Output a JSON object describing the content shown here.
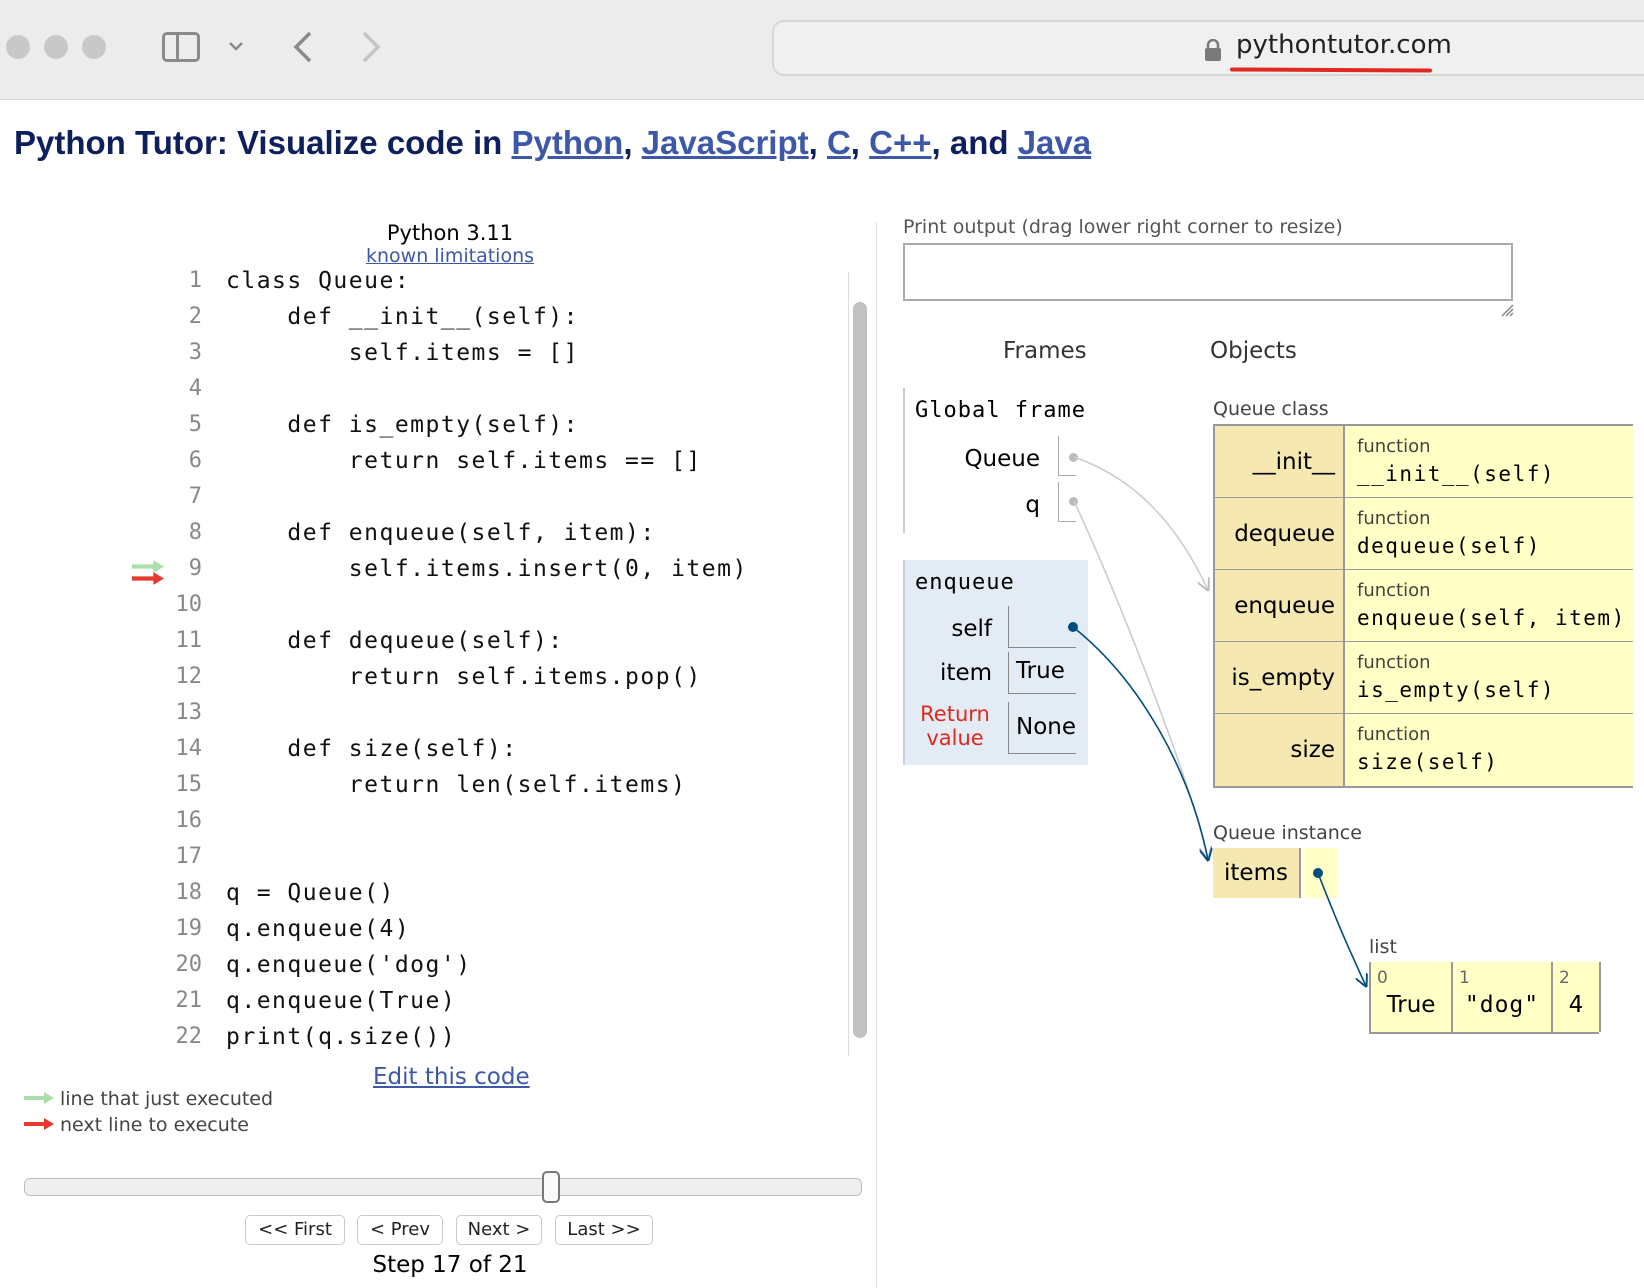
{
  "browser": {
    "url": "pythontutor.com"
  },
  "heading": {
    "prefix": "Python Tutor: Visualize code in ",
    "languages": [
      "Python",
      "JavaScript",
      "C",
      "C++",
      "Java"
    ],
    "sep1": ", ",
    "sep2": ", ",
    "sep3": ", ",
    "sep4": ", and "
  },
  "code_panel": {
    "language": "Python 3.11",
    "limitations_link": "known limitations",
    "lines": [
      "class Queue:",
      "    def __init__(self):",
      "        self.items = []",
      "",
      "    def is_empty(self):",
      "        return self.items == []",
      "",
      "    def enqueue(self, item):",
      "        self.items.insert(0, item)",
      "",
      "    def dequeue(self):",
      "        return self.items.pop()",
      "",
      "    def size(self):",
      "        return len(self.items)",
      "",
      "",
      "q = Queue()",
      "q.enqueue(4)",
      "q.enqueue('dog')",
      "q.enqueue(True)",
      "print(q.size())"
    ],
    "line_numbers": [
      "1",
      "2",
      "3",
      "4",
      "5",
      "6",
      "7",
      "8",
      "9",
      "10",
      "11",
      "12",
      "13",
      "14",
      "15",
      "16",
      "17",
      "18",
      "19",
      "20",
      "21",
      "22"
    ],
    "just_executed_line": 9,
    "next_line": 9,
    "edit_link": "Edit this code",
    "legend_just_executed": "line that just executed",
    "legend_next": "next line to execute"
  },
  "colors": {
    "just_executed_arrow": "#a9dfa9",
    "next_arrow": "#e8392f",
    "link": "#3d58a8",
    "heading": "#0d1f5c",
    "frame_bg": "#e3ebf5",
    "object_bg": "#ffffc6",
    "object_key_bg": "#f5e8b0",
    "pointer": "#004d80"
  },
  "navigation": {
    "first": "<< First",
    "prev": "< Prev",
    "next": "Next >",
    "last": "Last >>",
    "step_text": "Step 17 of 21",
    "current_step": 17,
    "total_steps": 21
  },
  "viz": {
    "print_output_label": "Print output (drag lower right corner to resize)",
    "frames_header": "Frames",
    "objects_header": "Objects",
    "global_frame": {
      "title": "Global frame",
      "vars": [
        "Queue",
        "q"
      ]
    },
    "enqueue_frame": {
      "title": "enqueue",
      "vars": [
        {
          "name": "self",
          "value": ""
        },
        {
          "name": "item",
          "value": "True"
        },
        {
          "name": "Return value",
          "value": "None"
        }
      ],
      "return_label_1": "Return",
      "return_label_2": "value"
    },
    "queue_class": {
      "label": "Queue class",
      "methods": [
        {
          "name": "__init__",
          "type": "function",
          "sig": "__init__(self)"
        },
        {
          "name": "dequeue",
          "type": "function",
          "sig": "dequeue(self)"
        },
        {
          "name": "enqueue",
          "type": "function",
          "sig": "enqueue(self, item)"
        },
        {
          "name": "is_empty",
          "type": "function",
          "sig": "is_empty(self)"
        },
        {
          "name": "size",
          "type": "function",
          "sig": "size(self)"
        }
      ]
    },
    "queue_instance": {
      "label": "Queue instance",
      "attr": "items"
    },
    "list": {
      "label": "list",
      "indices": [
        "0",
        "1",
        "2"
      ],
      "values": [
        "True",
        "\"dog\"",
        "4"
      ]
    }
  }
}
